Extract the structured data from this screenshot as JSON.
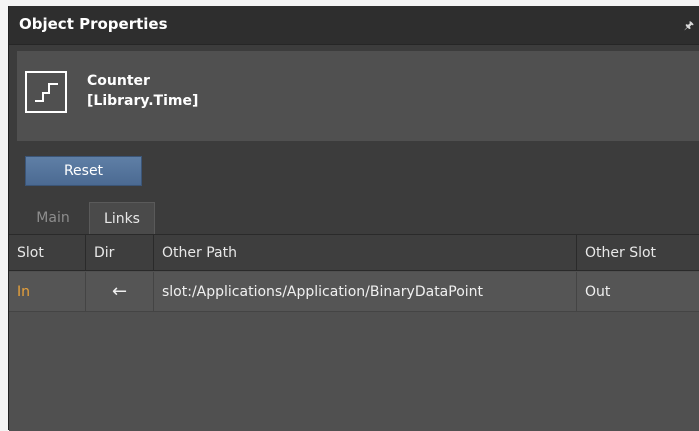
{
  "panel": {
    "title": "Object Properties",
    "pin_icon": "pin-icon"
  },
  "object": {
    "name": "Counter",
    "library": "[Library.Time]",
    "icon": "step-function-icon"
  },
  "toolbar": {
    "reset_label": "Reset"
  },
  "tabs": [
    {
      "label": "Main",
      "active": false
    },
    {
      "label": "Links",
      "active": true
    }
  ],
  "links_table": {
    "columns": [
      "Slot",
      "Dir",
      "Other Path",
      "Other Slot"
    ],
    "rows": [
      {
        "slot": "In",
        "dir": "←",
        "other_path": "slot:/Applications/Application/BinaryDataPoint",
        "other_slot": "Out"
      }
    ]
  },
  "colors": {
    "panel_bg": "#3c3c3c",
    "title_bg": "#2e2e2e",
    "button": "#5a7aa2",
    "slot_text": "#e8a13a"
  }
}
